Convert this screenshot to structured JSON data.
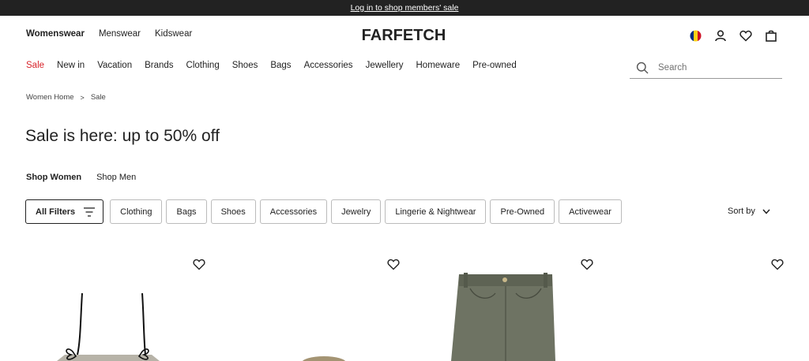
{
  "promo": {
    "text": "Log in to shop members' sale"
  },
  "departments": [
    "Womenswear",
    "Menswear",
    "Kidswear"
  ],
  "brand": {
    "logo": "FARFETCH"
  },
  "header_icons": [
    "flag-icon",
    "account-icon",
    "wishlist-icon",
    "bag-icon"
  ],
  "main_nav": [
    "Sale",
    "New in",
    "Vacation",
    "Brands",
    "Clothing",
    "Shoes",
    "Bags",
    "Accessories",
    "Jewellery",
    "Homeware",
    "Pre-owned"
  ],
  "search": {
    "placeholder": "Search"
  },
  "breadcrumb": {
    "home": "Women Home",
    "current": "Sale"
  },
  "page": {
    "title": "Sale is here: up to 50% off"
  },
  "shop_tabs": [
    "Shop Women",
    "Shop Men"
  ],
  "filters": {
    "all_label": "All Filters",
    "chips": [
      "Clothing",
      "Bags",
      "Shoes",
      "Accessories",
      "Jewelry",
      "Lingerie & Nightwear",
      "Pre-Owned",
      "Activewear"
    ]
  },
  "sort": {
    "label": "Sort by"
  },
  "colors": {
    "accent_sale": "#d8232a",
    "promo_bg": "#222222"
  }
}
